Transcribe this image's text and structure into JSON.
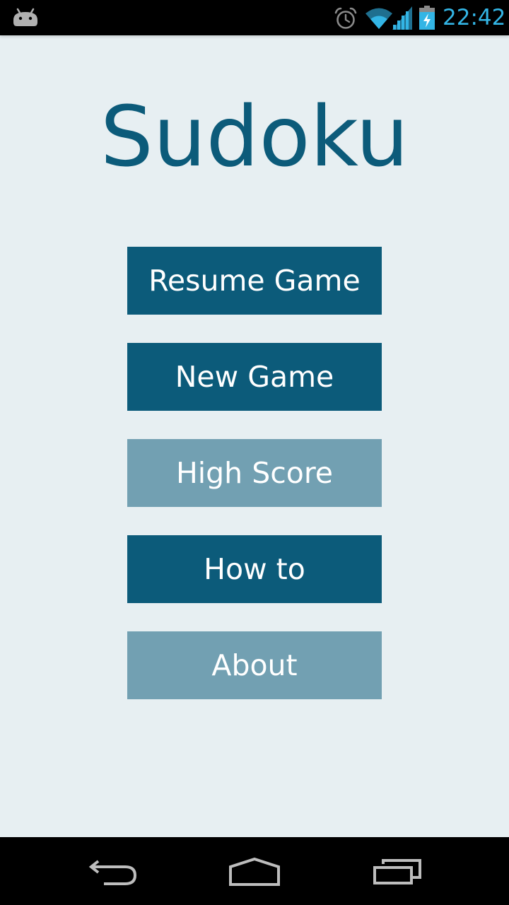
{
  "status_bar": {
    "time": "22:42",
    "time_color": "#33b5e5",
    "icons": [
      "android-debug-icon",
      "alarm-icon",
      "wifi-icon",
      "signal-icon",
      "battery-charging-icon"
    ]
  },
  "app": {
    "title": "Sudoku",
    "title_color": "#0c5b7a",
    "background_color": "#e7eff2"
  },
  "menu": {
    "buttons": [
      {
        "label": "Resume Game",
        "style": "dark",
        "color": "#0c5b7a"
      },
      {
        "label": "New Game",
        "style": "dark",
        "color": "#0c5b7a"
      },
      {
        "label": "High Score",
        "style": "light",
        "color": "#72a0b2"
      },
      {
        "label": "How to",
        "style": "dark",
        "color": "#0c5b7a"
      },
      {
        "label": "About",
        "style": "light",
        "color": "#72a0b2"
      }
    ]
  },
  "nav_bar": {
    "icons": [
      "back-icon",
      "home-icon",
      "recent-apps-icon"
    ]
  }
}
